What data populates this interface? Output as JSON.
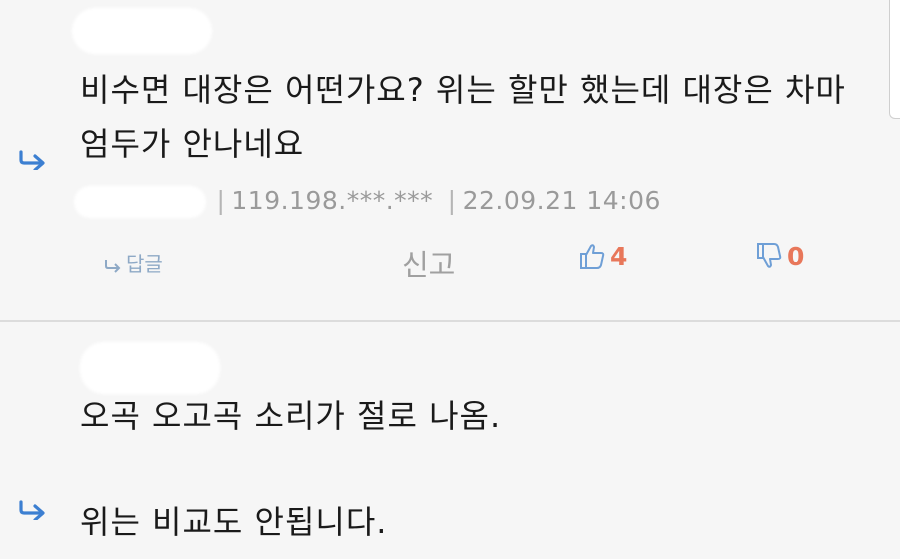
{
  "comments": [
    {
      "body": "비수면 대장은 어떤가요? 위는 할만 했는데 대장은 차마\n엄두가 안나네요",
      "ip": "119.198.***.***",
      "date": "22.09.21 14:06",
      "actions": {
        "reply_label": "답글",
        "report_label": "신고",
        "likes": "4",
        "dislikes": "0"
      }
    },
    {
      "body": "오곡 오고곡 소리가 절로 나옴.\n\n위는 비교도 안됩니다."
    }
  ],
  "colors": {
    "background": "#f6f6f6",
    "reply_arrow": "#3c7fd1",
    "vote_count": "#e8775a",
    "vote_icon": "#6f9fd6"
  }
}
